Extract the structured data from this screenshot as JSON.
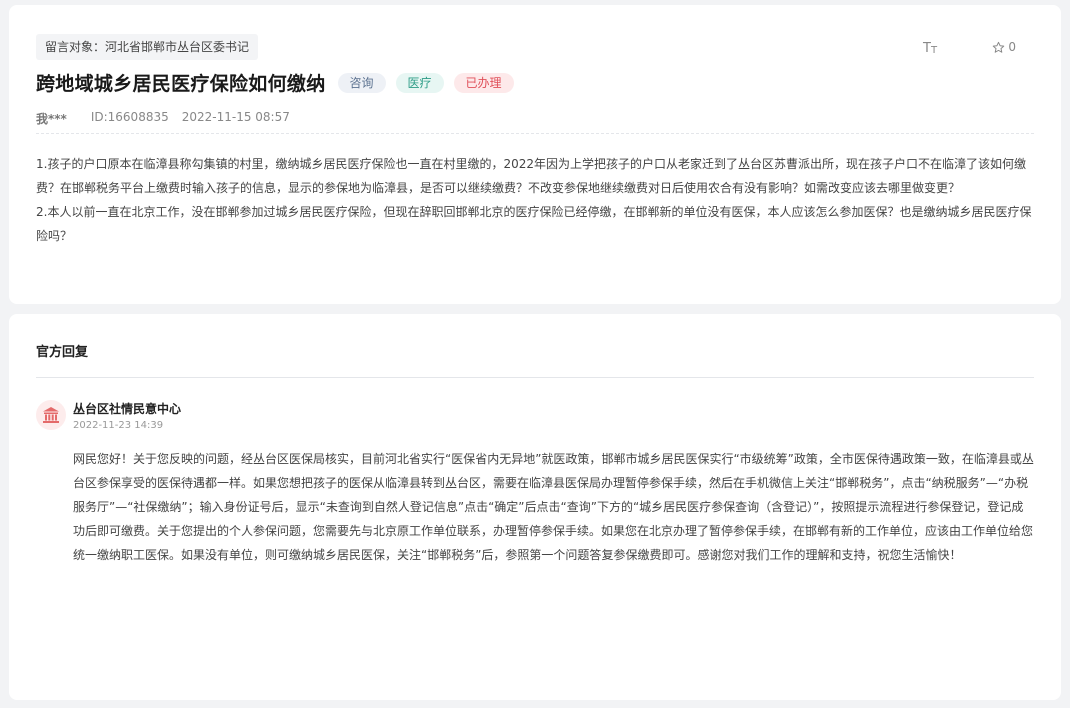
{
  "question": {
    "target": "留言对象：河北省邯郸市丛台区委书记",
    "title": "跨地域城乡居民医疗保险如何缴纳",
    "tags": [
      "咨询",
      "医疗",
      "已办理"
    ],
    "author": "我***",
    "id_text": "ID:16608835",
    "time": "2022-11-15 08:57",
    "favorite_count": "0",
    "paragraphs": [
      "1.孩子的户口原本在临漳县称勾集镇的村里，缴纳城乡居民医疗保险也一直在村里缴的，2022年因为上学把孩子的户口从老家迁到了丛台区苏曹派出所，现在孩子户口不在临漳了该如何缴费？在邯郸税务平台上缴费时输入孩子的信息，显示的参保地为临漳县，是否可以继续缴费？不改变参保地继续缴费对日后使用农合有没有影响？如需改变应该去哪里做变更？",
      "2.本人以前一直在北京工作，没在邯郸参加过城乡居民医疗保险，但现在辞职回邯郸北京的医疗保险已经停缴，在邯郸新的单位没有医保，本人应该怎么参加医保？也是缴纳城乡居民医疗保险吗？"
    ]
  },
  "reply": {
    "heading": "官方回复",
    "org_name": "丛台区社情民意中心",
    "time": "2022-11-23 14:39",
    "body": "网民您好！关于您反映的问题，经丛台区医保局核实，目前河北省实行“医保省内无异地”就医政策，邯郸市城乡居民医保实行“市级统筹”政策，全市医保待遇政策一致，在临漳县或丛台区参保享受的医保待遇都一样。如果您想把孩子的医保从临漳县转到丛台区，需要在临漳县医保局办理暂停参保手续，然后在手机微信上关注“邯郸税务”，点击“纳税服务”—“办税服务厅”—“社保缴纳”；输入身份证号后，显示“未查询到自然人登记信息”点击“确定”后点击“查询”下方的“城乡居民医疗参保查询（含登记）”，按照提示流程进行参保登记，登记成功后即可缴费。关于您提出的个人参保问题，您需要先与北京原工作单位联系，办理暂停参保手续。如果您在北京办理了暂停参保手续，在邯郸有新的工作单位，应该由工作单位给您统一缴纳职工医保。如果没有单位，则可缴纳城乡居民医保，关注“邯郸税务”后，参照第一个问题答复参保缴费即可。感谢您对我们工作的理解和支持，祝您生活愉快！"
  },
  "icons": {
    "font_size": "font-size-icon",
    "favorite": "star-icon",
    "org": "institution-icon"
  },
  "colors": {
    "tag_consult": "#5c7290",
    "tag_medical": "#2c9c86",
    "tag_done": "#e0505a",
    "org_icon": "#e46a6a"
  }
}
